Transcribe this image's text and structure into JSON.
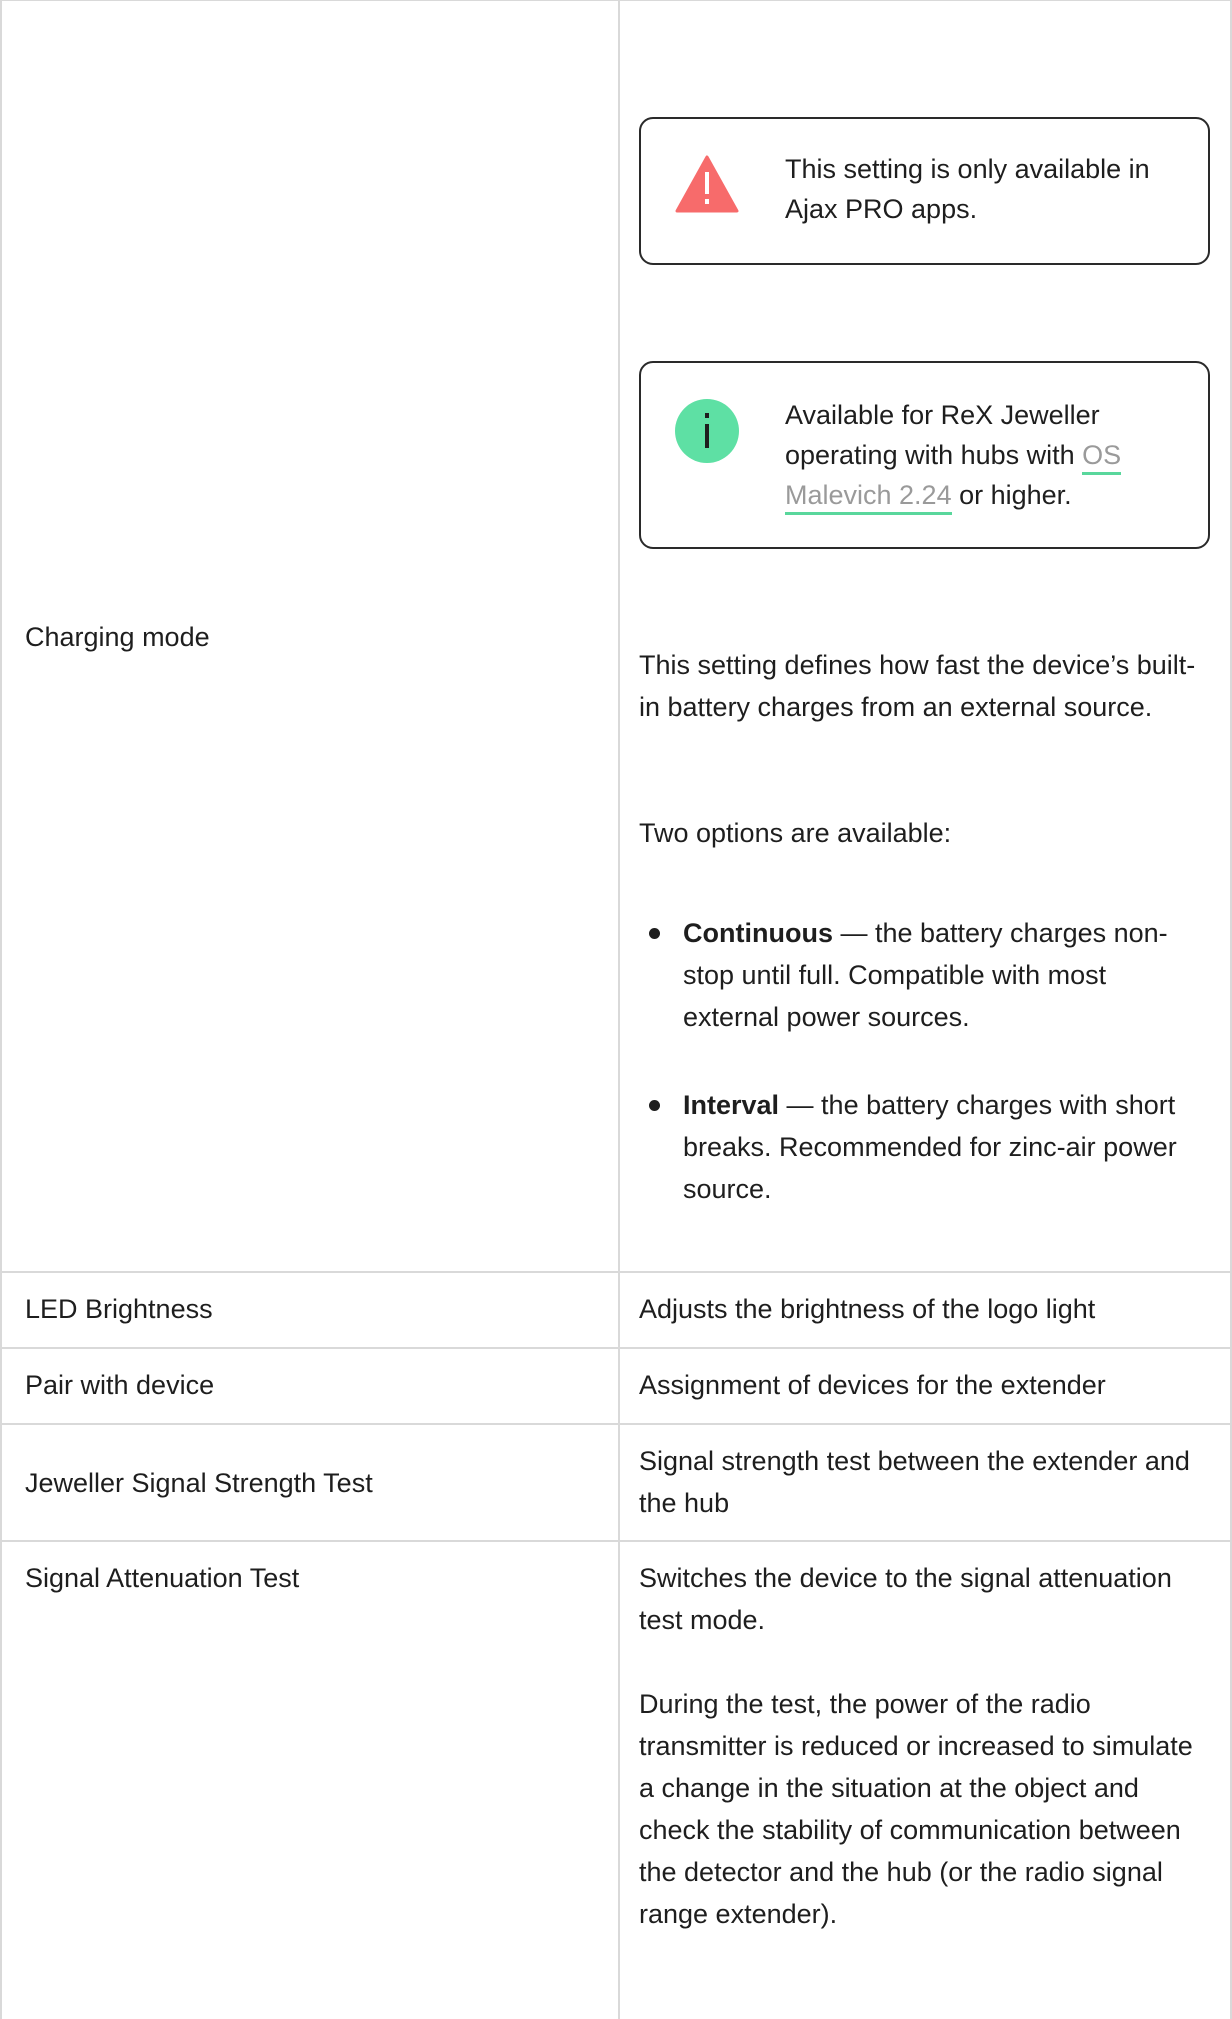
{
  "notices": {
    "warning": {
      "icon": "warning-triangle-icon",
      "text": "This setting is only available in Ajax PRO apps."
    },
    "info": {
      "icon": "info-icon",
      "text_before": "Available for ReX Jeweller operating with hubs with ",
      "link_part1": "OS",
      "link_part2": "Malevich 2.24",
      "text_after": " or higher."
    }
  },
  "rows": {
    "charging": {
      "label": "Charging mode",
      "description": "This setting defines how fast the device’s built-in battery charges from an external source.",
      "options_intro": "Two options are available:",
      "options": [
        {
          "name": "Continuous",
          "text": " — the battery charges non-stop until full. Compatible with most external power sources."
        },
        {
          "name": "Interval",
          "text": " — the battery charges with short breaks. Recommended for zinc-air power source."
        }
      ]
    },
    "led": {
      "label": "LED Brightness",
      "description": "Adjusts the brightness of the logo light"
    },
    "pair": {
      "label": "Pair with device",
      "description": "Assignment of devices for the extender"
    },
    "jeweller": {
      "label": "Jeweller Signal Strength Test",
      "description": "Signal strength test between the extender and the hub"
    },
    "attenuation": {
      "label": "Signal Attenuation Test",
      "description": "Switches the device to the signal attenuation test mode.",
      "details": "During the test, the power of the radio transmitter is reduced or increased to simulate a change in the situation at the object and check the stability of communication between the detector and the hub (or the radio signal range extender)."
    }
  },
  "colors": {
    "warning": "#f76b6b",
    "info": "#5ee0a4",
    "link_underline": "#59d79c",
    "border": "#d9d9d9"
  }
}
